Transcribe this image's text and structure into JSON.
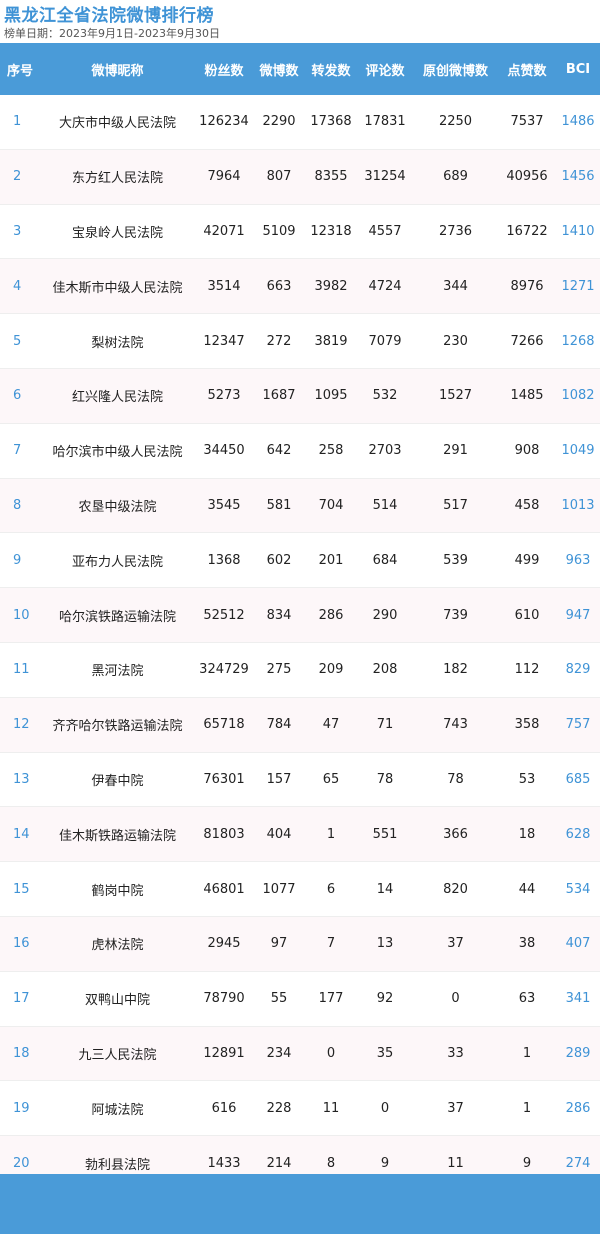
{
  "header": {
    "title": "黑龙江全省法院微博排行榜",
    "subtitle": "榜单日期：2023年9月1日-2023年9月30日"
  },
  "table": {
    "columns": [
      "序号",
      "微博昵称",
      "粉丝数",
      "微博数",
      "转发数",
      "评论数",
      "原创微博数",
      "点赞数",
      "BCI"
    ],
    "rows": [
      [
        "1",
        "大庆市中级人民法院",
        "126234",
        "2290",
        "17368",
        "17831",
        "2250",
        "7537",
        "1486"
      ],
      [
        "2",
        "东方红人民法院",
        "7964",
        "807",
        "8355",
        "31254",
        "689",
        "40956",
        "1456"
      ],
      [
        "3",
        "宝泉岭人民法院",
        "42071",
        "5109",
        "12318",
        "4557",
        "2736",
        "16722",
        "1410"
      ],
      [
        "4",
        "佳木斯市中级人民法院",
        "3514",
        "663",
        "3982",
        "4724",
        "344",
        "8976",
        "1271"
      ],
      [
        "5",
        "梨树法院",
        "12347",
        "272",
        "3819",
        "7079",
        "230",
        "7266",
        "1268"
      ],
      [
        "6",
        "红兴隆人民法院",
        "5273",
        "1687",
        "1095",
        "532",
        "1527",
        "1485",
        "1082"
      ],
      [
        "7",
        "哈尔滨市中级人民法院",
        "34450",
        "642",
        "258",
        "2703",
        "291",
        "908",
        "1049"
      ],
      [
        "8",
        "农垦中级法院",
        "3545",
        "581",
        "704",
        "514",
        "517",
        "458",
        "1013"
      ],
      [
        "9",
        "亚布力人民法院",
        "1368",
        "602",
        "201",
        "684",
        "539",
        "499",
        "963"
      ],
      [
        "10",
        "哈尔滨铁路运输法院",
        "52512",
        "834",
        "286",
        "290",
        "739",
        "610",
        "947"
      ],
      [
        "11",
        "黑河法院",
        "324729",
        "275",
        "209",
        "208",
        "182",
        "112",
        "829"
      ],
      [
        "12",
        "齐齐哈尔铁路运输法院",
        "65718",
        "784",
        "47",
        "71",
        "743",
        "358",
        "757"
      ],
      [
        "13",
        "伊春中院",
        "76301",
        "157",
        "65",
        "78",
        "78",
        "53",
        "685"
      ],
      [
        "14",
        "佳木斯铁路运输法院",
        "81803",
        "404",
        "1",
        "551",
        "366",
        "18",
        "628"
      ],
      [
        "15",
        "鹤岗中院",
        "46801",
        "1077",
        "6",
        "14",
        "820",
        "44",
        "534"
      ],
      [
        "16",
        "虎林法院",
        "2945",
        "97",
        "7",
        "13",
        "37",
        "38",
        "407"
      ],
      [
        "17",
        "双鸭山中院",
        "78790",
        "55",
        "177",
        "92",
        "0",
        "63",
        "341"
      ],
      [
        "18",
        "九三人民法院",
        "12891",
        "234",
        "0",
        "35",
        "33",
        "1",
        "289"
      ],
      [
        "19",
        "阿城法院",
        "616",
        "228",
        "11",
        "0",
        "37",
        "1",
        "286"
      ],
      [
        "20",
        "勃利县法院",
        "1433",
        "214",
        "8",
        "9",
        "11",
        "9",
        "274"
      ]
    ]
  },
  "colors": {
    "accent": "#4a9bd8",
    "title": "#3f93d6",
    "row_alt": "#fdf7f9"
  }
}
